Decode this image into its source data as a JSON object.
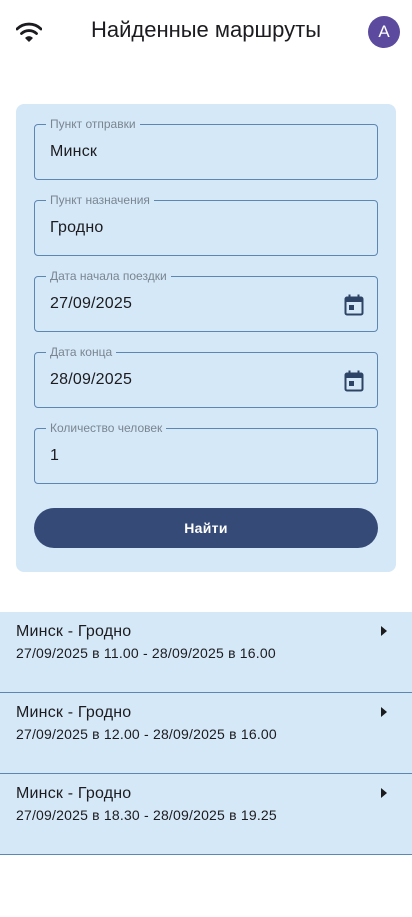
{
  "header": {
    "title": "Найденные маршруты",
    "avatar_letter": "A",
    "avatar_color": "#5c4a9e",
    "status_icon": "wifi-icon"
  },
  "form": {
    "departure": {
      "label": "Пункт отправки",
      "value": "Минск"
    },
    "destination": {
      "label": "Пункт назначения",
      "value": "Гродно"
    },
    "start_date": {
      "label": "Дата начала поездки",
      "value": "27/09/2025",
      "icon": "calendar-icon"
    },
    "end_date": {
      "label": "Дата конца",
      "value": "28/09/2025",
      "icon": "calendar-icon"
    },
    "people": {
      "label": "Количество человек",
      "value": "1"
    },
    "search_button": "Найти"
  },
  "routes": [
    {
      "title": "Минск - Гродно",
      "time": "27/09/2025 в 11.00 - 28/09/2025 в 16.00"
    },
    {
      "title": "Минск - Гродно",
      "time": "27/09/2025 в 12.00 - 28/09/2025 в 16.00"
    },
    {
      "title": "Минск - Гродно",
      "time": "27/09/2025 в 18.30 - 28/09/2025 в 19.25"
    }
  ],
  "colors": {
    "card_background": "#d5e8f7",
    "border": "#5d87b3",
    "button": "#364a77"
  }
}
